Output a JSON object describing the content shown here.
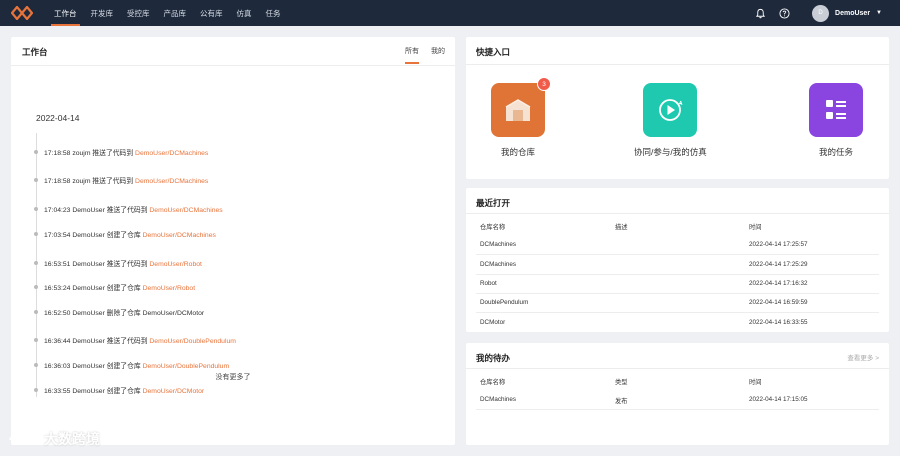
{
  "nav": {
    "items": [
      "工作台",
      "开发库",
      "受控库",
      "产品库",
      "公有库",
      "仿真",
      "任务"
    ],
    "active_index": 0,
    "user": {
      "avatar_letter": "D",
      "name": "DemoUser"
    }
  },
  "workbench": {
    "title": "工作台",
    "tabs": [
      "所有",
      "我的"
    ],
    "active_tab": 0,
    "date": "2022-04-14",
    "events": [
      {
        "text": "17:18:58 zoujm 推送了代码到 ",
        "repo": "DemoUser/DCMachines"
      },
      {
        "text": "17:18:58 zoujm 推送了代码到 ",
        "repo": "DemoUser/DCMachines"
      },
      {
        "text": "17:04:23 DemoUser 推送了代码到 ",
        "repo": "DemoUser/DCMachines"
      },
      {
        "text": "17:03:54 DemoUser 创建了仓库 ",
        "repo": "DemoUser/DCMachines"
      },
      {
        "text": "16:53:51 DemoUser 推送了代码到 ",
        "repo": "DemoUser/Robot"
      },
      {
        "text": "16:53:24 DemoUser 创建了仓库 ",
        "repo": "DemoUser/Robot"
      },
      {
        "text": "16:52:50 DemoUser 删除了仓库 DemoUser/DCMotor",
        "repo": ""
      },
      {
        "text": "16:36:44 DemoUser 推送了代码到 ",
        "repo": "DemoUser/DoublePendulum"
      },
      {
        "text": "16:36:03 DemoUser 创建了仓库 ",
        "repo": "DemoUser/DoublePendulum"
      },
      {
        "text": "16:33:55 DemoUser 创建了仓库 ",
        "repo": "DemoUser/DCMotor"
      }
    ],
    "no_more": "没有更多了"
  },
  "quick": {
    "title": "快捷入口",
    "items": [
      {
        "label": "我的仓库",
        "color": "#e07436",
        "icon": "warehouse-icon",
        "badge": "3"
      },
      {
        "label": "协同/参与/我的仿真",
        "color": "#1ec9b0",
        "icon": "play-icon",
        "badge": ""
      },
      {
        "label": "我的任务",
        "color": "#8a44e0",
        "icon": "task-list-icon",
        "badge": ""
      }
    ]
  },
  "recent": {
    "title": "最近打开",
    "headers": [
      "仓库名称",
      "描述",
      "时间"
    ],
    "rows": [
      {
        "name": "DCMachines",
        "desc": "",
        "time": "2022-04-14 17:25:57"
      },
      {
        "name": "DCMachines",
        "desc": "",
        "time": "2022-04-14 17:25:29"
      },
      {
        "name": "Robot",
        "desc": "",
        "time": "2022-04-14 17:16:32"
      },
      {
        "name": "DoublePendulum",
        "desc": "",
        "time": "2022-04-14 16:59:59"
      },
      {
        "name": "DCMotor",
        "desc": "",
        "time": "2022-04-14 16:33:55"
      }
    ]
  },
  "todo": {
    "title": "我的待办",
    "more": "查看更多 >",
    "headers": [
      "仓库名称",
      "类型",
      "时间"
    ],
    "rows": [
      {
        "name": "DCMachines",
        "type": "发布",
        "time": "2022-04-14 17:15:05"
      }
    ]
  },
  "watermark": "大数跨境",
  "colors": {
    "accent": "#e8743b",
    "nav_bg": "#1e2a3c"
  }
}
